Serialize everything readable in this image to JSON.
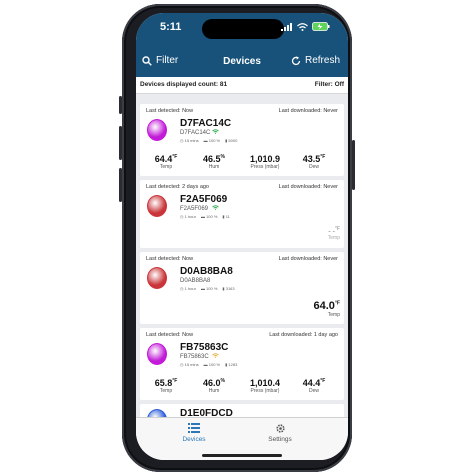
{
  "status": {
    "time": "5:11"
  },
  "header": {
    "title": "Devices",
    "filter_label": "Filter",
    "refresh_label": "Refresh"
  },
  "summary": {
    "count_text": "Devices displayed count: 81",
    "filter_text": "Filter: Off"
  },
  "cards": [
    {
      "last_detected": "Last detected: Now",
      "last_downloaded": "Last downloaded: Never",
      "name": "D7FAC14C",
      "id": "D7FAC14C",
      "color": "#c21ad8",
      "meta": [
        "15 mins",
        "100 %",
        "5000"
      ],
      "metrics": [
        {
          "value": "64.4",
          "unit": "°F",
          "label": "Temp"
        },
        {
          "value": "46.5",
          "unit": "%",
          "label": "Hum"
        },
        {
          "value": "1,010.9",
          "unit": "",
          "label": "Press (mbar)"
        },
        {
          "value": "43.5",
          "unit": "°F",
          "label": "Dew"
        }
      ]
    },
    {
      "last_detected": "Last detected: 2 days ago",
      "last_downloaded": "Last downloaded: Never",
      "name": "F2A5F069",
      "id": "F2A5F069",
      "color": "#c9353a",
      "meta": [
        "1 hour",
        "100 %",
        "11"
      ],
      "metrics": [
        {
          "value": "- -",
          "unit": "°F",
          "label": "Temp"
        }
      ]
    },
    {
      "last_detected": "Last detected: Now",
      "last_downloaded": "Last downloaded: Never",
      "name": "D0AB8BA8",
      "id": "D0AB8BA8",
      "color": "#c9353a",
      "meta": [
        "1 hour",
        "100 %",
        "3163"
      ],
      "metrics": [
        {
          "value": "64.0",
          "unit": "°F",
          "label": "Temp"
        }
      ]
    },
    {
      "last_detected": "Last detected: Now",
      "last_downloaded": "Last downloaded: 1 day ago",
      "name": "FB75863C",
      "id": "FB75863C",
      "color": "#c21ad8",
      "meta": [
        "15 mins",
        "100 %",
        "1283"
      ],
      "metrics": [
        {
          "value": "65.8",
          "unit": "°F",
          "label": "Temp"
        },
        {
          "value": "46.0",
          "unit": "%",
          "label": "Hum"
        },
        {
          "value": "1,010.4",
          "unit": "",
          "label": "Press (mbar)"
        },
        {
          "value": "44.4",
          "unit": "°F",
          "label": "Dew"
        }
      ]
    },
    {
      "name": "D1E0FDCD",
      "color": "#2a5bd7"
    }
  ],
  "tabs": [
    {
      "label": "Devices"
    },
    {
      "label": "Settings"
    }
  ],
  "colors": {
    "header": "#18527a",
    "tab_active": "#2a78b8",
    "tab_inactive": "#666666"
  },
  "icons": [
    "search-icon",
    "refresh-icon",
    "wifi-icon",
    "battery-icon",
    "devices-list-icon",
    "settings-gear-icon"
  ]
}
